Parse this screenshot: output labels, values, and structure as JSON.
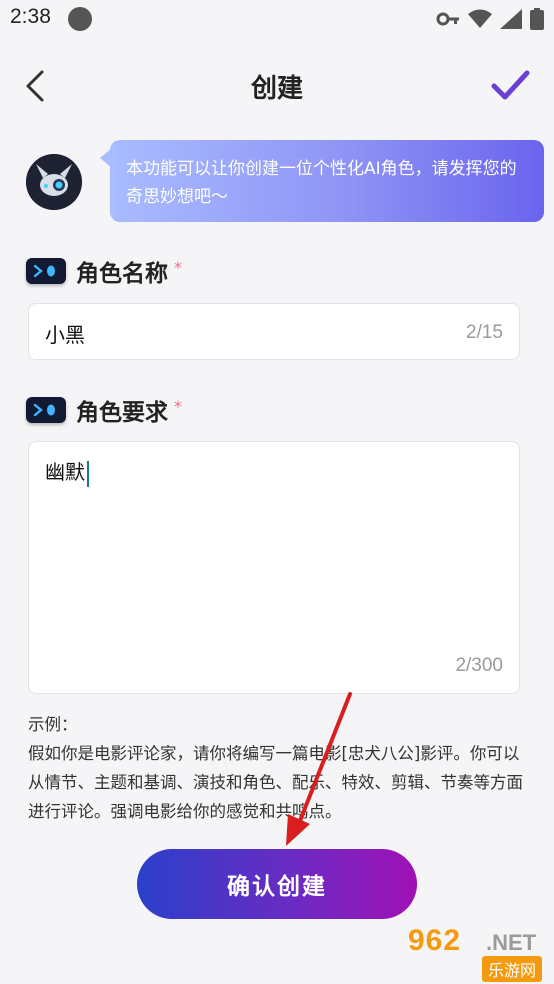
{
  "status_bar": {
    "time": "2:38"
  },
  "header": {
    "title": "创建"
  },
  "assistant": {
    "message": "本功能可以让你创建一位个性化AI角色，请发挥您的奇思妙想吧～"
  },
  "name_field": {
    "label": "角色名称",
    "required": "*",
    "value": "小黑",
    "counter": "2/15"
  },
  "requirement_field": {
    "label": "角色要求",
    "required": "*",
    "value": "幽默",
    "counter": "2/300"
  },
  "example": {
    "heading": "示例：",
    "text": "假如你是电影评论家，请你将编写一篇电影[忠犬八公]影评。你可以从情节、主题和基调、演技和角色、配乐、特效、剪辑、节奏等方面进行评论。强调电影给你的感觉和共鸣点。"
  },
  "create_button": {
    "label": "确认创建"
  },
  "watermark": {
    "main": "962",
    "net": ".NET",
    "sub": "乐游网"
  },
  "colors": {
    "accent": "#6a3fd6",
    "required": "#f06b8a",
    "button_gradient_start": "#2b40c9",
    "button_gradient_end": "#a011b4",
    "annotation_arrow": "#d81e1e"
  },
  "icons": {
    "back": "chevron-left-icon",
    "confirm": "checkmark-icon",
    "label_badge": "terminal-prompt-icon",
    "status": [
      "key-icon",
      "wifi-icon",
      "signal-icon",
      "battery-icon"
    ]
  }
}
